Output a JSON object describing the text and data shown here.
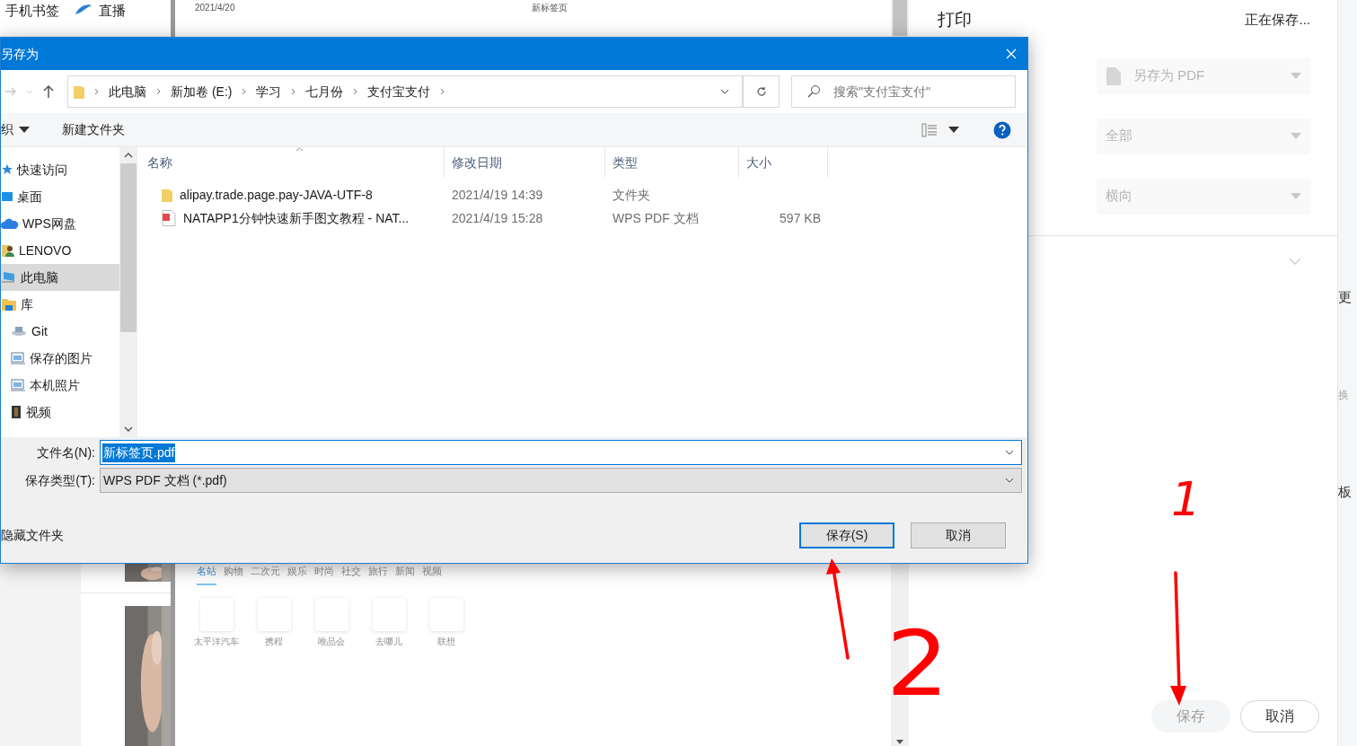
{
  "browser_sidebar": {
    "bookmarks": [
      {
        "kind": "phone",
        "label": "手机书签"
      },
      {
        "kind": "live",
        "label": "直播"
      }
    ]
  },
  "preview_page": {
    "header_texts": [
      "2021/4/20",
      "新标签页"
    ],
    "nav_tabs": [
      {
        "label": "名站",
        "selected": true
      },
      {
        "label": "购物",
        "selected": false
      },
      {
        "label": "二次元",
        "selected": false
      },
      {
        "label": "娱乐",
        "selected": false
      },
      {
        "label": "时尚",
        "selected": false
      },
      {
        "label": "社交",
        "selected": false
      },
      {
        "label": "旅行",
        "selected": false
      },
      {
        "label": "新闻",
        "selected": false
      },
      {
        "label": "视频",
        "selected": false
      }
    ],
    "sites": [
      {
        "label": "太平洋汽车"
      },
      {
        "label": "携程"
      },
      {
        "label": "唯品会"
      },
      {
        "label": "去哪儿"
      },
      {
        "label": "联想"
      }
    ]
  },
  "print_panel": {
    "title": "打印",
    "status": "正在保存...",
    "selects": [
      {
        "kind": "destination",
        "value": "另存为 PDF"
      },
      {
        "kind": "plain",
        "value": "全部"
      },
      {
        "kind": "plain",
        "value": "横向"
      }
    ],
    "buttons": [
      {
        "label": "保存",
        "primary": true
      },
      {
        "label": "取消",
        "primary": false
      }
    ]
  },
  "edge_texts": [
    "更",
    "换",
    "板"
  ],
  "dialog": {
    "title": "另存为",
    "breadcrumb": [
      "此电脑",
      "新加卷 (E:)",
      "学习",
      "七月份",
      "支付宝支付"
    ],
    "search": {
      "placeholder": "搜索\"支付宝支付\""
    },
    "toolbar": {
      "organize": "织",
      "new_folder": "新建文件夹"
    },
    "nav": [
      {
        "kind": "star",
        "label": "快速访问",
        "selected": false
      },
      {
        "kind": "desktop",
        "label": "桌面",
        "selected": false
      },
      {
        "kind": "cloud",
        "label": "WPS网盘",
        "selected": false
      },
      {
        "kind": "user",
        "label": "LENOVO",
        "selected": false
      },
      {
        "kind": "computer",
        "label": "此电脑",
        "selected": true
      },
      {
        "kind": "library",
        "label": "库",
        "selected": false,
        "children": [
          {
            "kind": "git",
            "label": "Git",
            "selected": false
          },
          {
            "kind": "pictures",
            "label": "保存的图片",
            "selected": false
          },
          {
            "kind": "pictures",
            "label": "本机照片",
            "selected": false
          },
          {
            "kind": "video",
            "label": "视频",
            "selected": false
          }
        ]
      }
    ],
    "columns": [
      "名称",
      "修改日期",
      "类型",
      "大小"
    ],
    "rows": [
      {
        "kind": "folder",
        "name": "alipay.trade.page.pay-JAVA-UTF-8",
        "date": "2021/4/19 14:39",
        "type": "文件夹"
      },
      {
        "kind": "pdf",
        "name": "NATAPP1分钟快速新手图文教程 - NAT...",
        "date": "2021/4/19 15:28",
        "type": "WPS PDF 文档",
        "size": "597 KB"
      }
    ],
    "file_name": {
      "label": "文件名(N):",
      "value": "新标签页.pdf",
      "text_selected": true
    },
    "file_type": {
      "label": "保存类型(T):",
      "value": "WPS PDF 文档 (*.pdf)"
    },
    "hide_folders": "隐藏文件夹",
    "buttons": [
      {
        "label": "保存(S)",
        "default": true
      },
      {
        "label": "取消",
        "default": false
      }
    ]
  },
  "annotations": [
    {
      "label": "2"
    },
    {
      "label": "1"
    }
  ]
}
